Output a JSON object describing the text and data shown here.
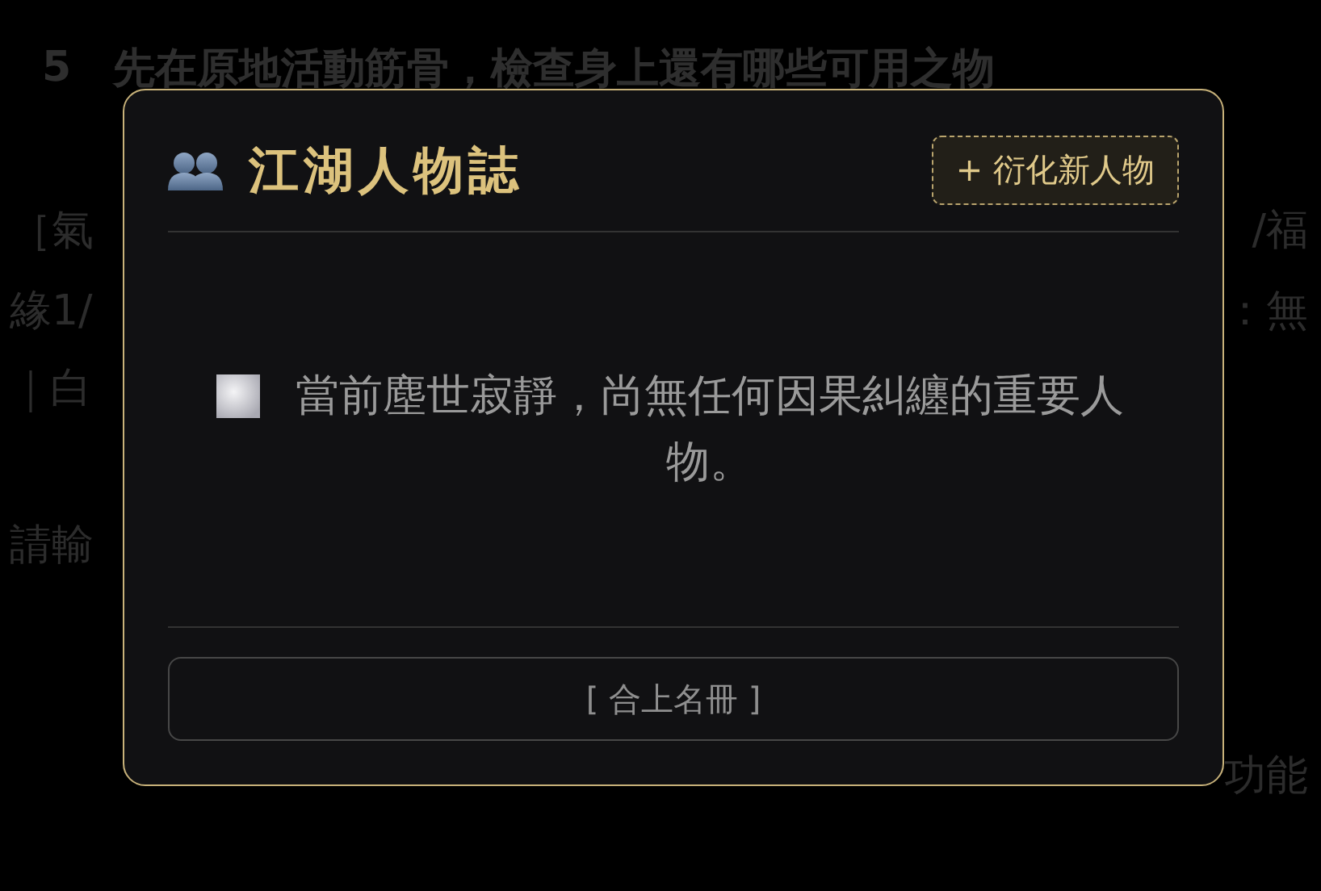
{
  "background": {
    "step": {
      "number": "5",
      "text": "先在原地活動筋骨，檢查身上還有哪些可用之物"
    },
    "lines": [
      {
        "left": "［氣",
        "right": "/福"
      },
      {
        "left": "緣1/",
        "right": "：無"
      },
      {
        "left": "｜白"
      },
      {
        "left": "請輸"
      },
      {
        "right": "功能"
      }
    ]
  },
  "dialog": {
    "title": "江湖人物誌",
    "add_button": "+ 衍化新人物",
    "empty_message": "當前塵世寂靜，尚無任何因果糾纏的重要人物。",
    "close_button": "[ 合上名冊 ]"
  }
}
